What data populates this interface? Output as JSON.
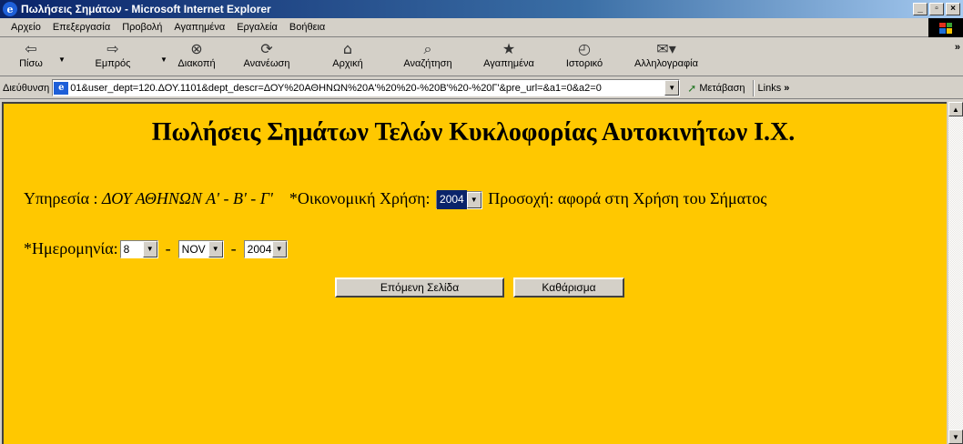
{
  "window": {
    "title": "Πωλήσεις Σημάτων - Microsoft Internet Explorer",
    "app_icon": "e",
    "minimize": "_",
    "maximize": "▫",
    "close": "×"
  },
  "menu": {
    "items": [
      "Αρχείο",
      "Επεξεργασία",
      "Προβολή",
      "Αγαπημένα",
      "Εργαλεία",
      "Βοήθεια"
    ]
  },
  "toolbar": {
    "back": "Πίσω",
    "forward": "Εμπρός",
    "stop": "Διακοπή",
    "refresh": "Ανανέωση",
    "home": "Αρχική",
    "search": "Αναζήτηση",
    "favorites": "Αγαπημένα",
    "history": "Ιστορικό",
    "mail": "Αλληλογραφία",
    "more": "»"
  },
  "address": {
    "label": "Διεύθυνση",
    "url": "01&user_dept=120.ΔΟΥ.1101&dept_descr=ΔΟΥ%20ΑΘΗΝΩΝ%20Α'%20%20-%20Β'%20-%20Γ'&pre_url=&a1=0&a2=0",
    "go_label": "Μετάβαση",
    "links_label": "Links",
    "links_more": "»"
  },
  "page": {
    "title": "Πωλήσεις Σημάτων Τελών Κυκλοφορίας Αυτοκινήτων Ι.Χ.",
    "service_label": "Υπηρεσία :",
    "service_value": "ΔΟΥ ΑΘΗΝΩΝ Α' - Β' - Γ'",
    "fiscal_label": "*Οικονομική Χρήση:",
    "fiscal_year": "2004",
    "fiscal_note": "Προσοχή: αφορά στη Χρήση του Σήματος",
    "date_label": "*Ημερομηνία:",
    "day": "8",
    "month": "NOV",
    "year": "2004",
    "dash": "-",
    "next_button": "Επόμενη Σελίδα",
    "clear_button": "Καθάρισμα"
  },
  "colors": {
    "page_background": "#ffc800",
    "titlebar_start": "#0a246a",
    "titlebar_end": "#a6caf0"
  }
}
